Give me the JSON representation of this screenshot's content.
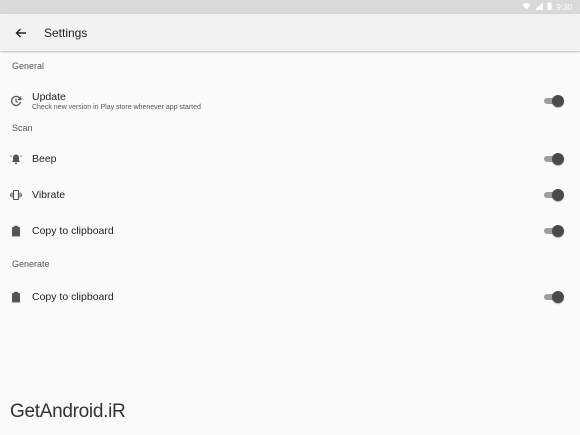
{
  "status_bar": {
    "time": "9:30"
  },
  "app_bar": {
    "title": "Settings",
    "back_icon": "arrow-back-icon"
  },
  "sections": {
    "general": {
      "header": "General",
      "update": {
        "icon": "update-icon",
        "title": "Update",
        "subtitle": "Check new version in Play store whenever app started",
        "enabled": true
      }
    },
    "scan": {
      "header": "Scan",
      "beep": {
        "icon": "bell-icon",
        "title": "Beep",
        "enabled": true
      },
      "vibrate": {
        "icon": "vibrate-icon",
        "title": "Vibrate",
        "enabled": true
      },
      "clipboard": {
        "icon": "clipboard-icon",
        "title": "Copy to clipboard",
        "enabled": true
      }
    },
    "generate": {
      "header": "Generate",
      "clipboard": {
        "icon": "clipboard-icon",
        "title": "Copy to clipboard",
        "enabled": true
      }
    }
  },
  "watermark": {
    "text": "GetAndroid.iR"
  },
  "colors": {
    "background": "#fafafa",
    "app_bar": "#f2f2f2",
    "toggle_thumb": "#4a4a4a",
    "toggle_track": "#9e9e9e"
  }
}
